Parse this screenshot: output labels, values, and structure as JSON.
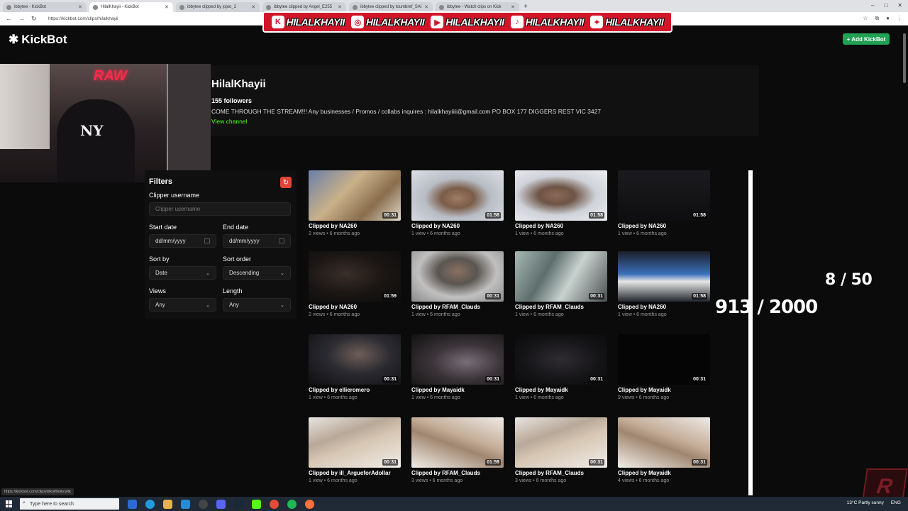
{
  "browser": {
    "tabs": [
      {
        "label": "ibbytee - KickBot",
        "active": false
      },
      {
        "label": "HilalKhayii - KickBot",
        "active": true
      },
      {
        "label": "ibbytee clipped by jojoo_2",
        "active": false
      },
      {
        "label": "ibbytee clipped by Angel_E255",
        "active": false
      },
      {
        "label": "ibbytee clipped by toumbref_SAI",
        "active": false
      },
      {
        "label": "ibbytee - Watch clips on Kick",
        "active": false
      }
    ],
    "url": "https://kickbot.com/clips/hilalkhayii",
    "status_url": "https://kickbot.com/clips/d/knif9oikcwtk"
  },
  "banner": {
    "handles": [
      {
        "icon": "kick-icon",
        "glyph": "K",
        "text": "HILALKHAYII"
      },
      {
        "icon": "instagram-icon",
        "glyph": "◎",
        "text": "HILALKHAYII"
      },
      {
        "icon": "youtube-icon",
        "glyph": "▶",
        "text": "HILALKHAYII"
      },
      {
        "icon": "tiktok-icon",
        "glyph": "♪",
        "text": "HILALKHAYII"
      },
      {
        "icon": "twitter-icon",
        "glyph": "✦",
        "text": "HILALKHAYII"
      }
    ]
  },
  "header": {
    "logo": "KickBot",
    "add_button": "+ Add KickBot"
  },
  "channel": {
    "name": "HilalKhayii",
    "followers": "155 followers",
    "bio": "COME THROUGH THE STREAM!!! Any businesses / Promos / collabs inquires : hilalkhayiiii@gmail.com PO BOX 177 DIGGERS REST VIC 3427",
    "view_link": "View channel"
  },
  "webcam": {
    "neon": "RAW",
    "cap_logo": "NY"
  },
  "filters": {
    "title": "Filters",
    "clipper_label": "Clipper username",
    "clipper_placeholder": "Clipper username",
    "start_label": "Start date",
    "start_value": "dd/mm/yyyy",
    "end_label": "End date",
    "end_value": "dd/mm/yyyy",
    "sort_by_label": "Sort by",
    "sort_by_value": "Date",
    "sort_order_label": "Sort order",
    "sort_order_value": "Descending",
    "views_label": "Views",
    "views_value": "Any",
    "length_label": "Length",
    "length_value": "Any"
  },
  "clips": [
    {
      "title": "Clipped by NA260",
      "meta": "2 views • 6 months ago",
      "duration": "00:31",
      "thumb": "store"
    },
    {
      "title": "Clipped by NA260",
      "meta": "1 view • 6 months ago",
      "duration": "01:58",
      "thumb": "face"
    },
    {
      "title": "Clipped by NA260",
      "meta": "1 view • 6 months ago",
      "duration": "01:58",
      "thumb": "face2"
    },
    {
      "title": "Clipped by NA260",
      "meta": "1 view • 6 months ago",
      "duration": "01:58",
      "thumb": "dark"
    },
    {
      "title": "Clipped by NA260",
      "meta": "2 views • 6 months ago",
      "duration": "01:59",
      "thumb": "darkface"
    },
    {
      "title": "Clipped by RFAM_Clauds",
      "meta": "1 view • 6 months ago",
      "duration": "00:31",
      "thumb": "hoodie"
    },
    {
      "title": "Clipped by RFAM_Clauds",
      "meta": "1 view • 6 months ago",
      "duration": "00:31",
      "thumb": "glass"
    },
    {
      "title": "Clipped by NA260",
      "meta": "1 view • 6 months ago",
      "duration": "01:58",
      "thumb": "hall"
    },
    {
      "title": "Clipped by ellieromero",
      "meta": "1 view • 6 months ago",
      "duration": "00:31",
      "thumb": "night"
    },
    {
      "title": "Clipped by Mayaidk",
      "meta": "1 view • 6 months ago",
      "duration": "00:31",
      "thumb": "blur"
    },
    {
      "title": "Clipped by Mayaidk",
      "meta": "1 view • 6 months ago",
      "duration": "00:31",
      "thumb": "dim"
    },
    {
      "title": "Clipped by Mayaidk",
      "meta": "9 views • 6 months ago",
      "duration": "00:31",
      "thumb": "black"
    },
    {
      "title": "Clipped by ill_ArgueforAdollar",
      "meta": "1 view • 6 months ago",
      "duration": "00:31",
      "thumb": "bed"
    },
    {
      "title": "Clipped by RFAM_Clauds",
      "meta": "3 views • 6 months ago",
      "duration": "01:59",
      "thumb": "bed2"
    },
    {
      "title": "Clipped by RFAM_Clauds",
      "meta": "3 views • 6 months ago",
      "duration": "00:31",
      "thumb": "bed"
    },
    {
      "title": "Clipped by Mayaidk",
      "meta": "4 views • 6 months ago",
      "duration": "00:31",
      "thumb": "bed2"
    }
  ],
  "overlay": {
    "counter_small": "8 / 50",
    "counter_large": "913 / 2000"
  },
  "taskbar": {
    "search_placeholder": "Type here to search",
    "weather": "13°C  Partly sunny",
    "lang": "ENG"
  },
  "badge": {
    "letter": "R"
  }
}
